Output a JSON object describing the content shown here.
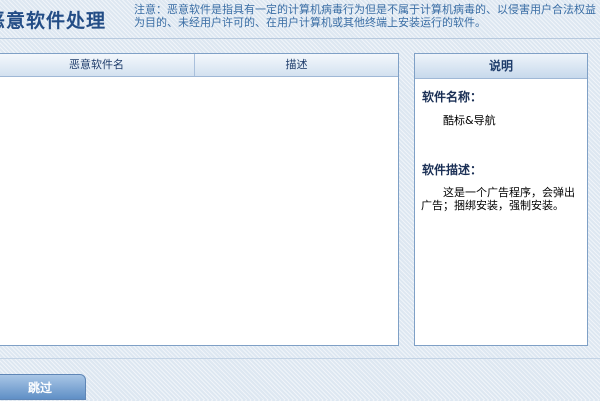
{
  "header": {
    "title": "恶意软件处理",
    "notice": "注意：恶意软件是指具有一定的计算机病毒行为但是不属于计算机病毒的、以侵害用户合法权益为目的、未经用户许可的、在用户计算机或其他终端上安装运行的软件。"
  },
  "list": {
    "columns": [
      "恶意软件名",
      "描述"
    ]
  },
  "info": {
    "title": "说明",
    "name_label": "软件名称：",
    "name_value": "酷标&导航",
    "desc_label": "软件描述：",
    "desc_value": "这是一个广告程序，会弹出广告；捆绑安装，强制安装。"
  },
  "footer": {
    "skip_label": "跳过"
  },
  "colors": {
    "title": "#234d86",
    "notice": "#3a6ea5",
    "panel_border": "#7fa0c6",
    "background": "#dde7f1"
  }
}
